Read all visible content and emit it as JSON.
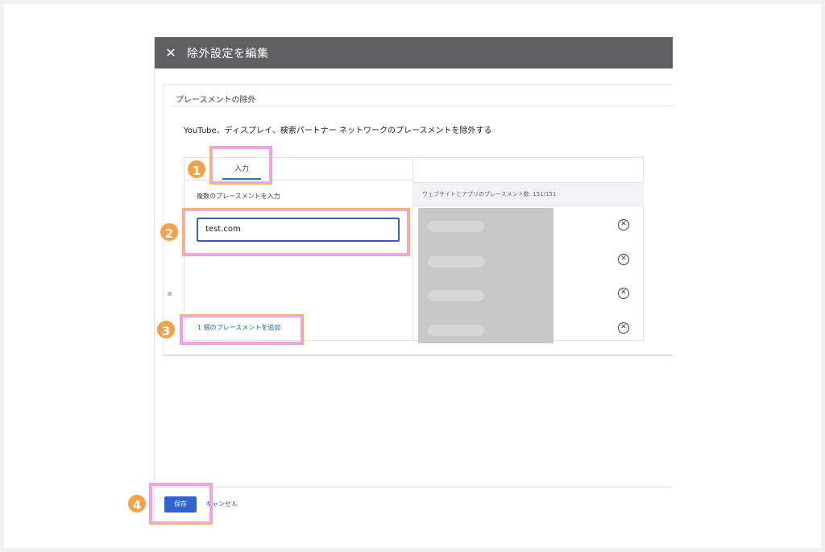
{
  "dialog": {
    "title": "除外設定を編集",
    "close_icon": "close-icon"
  },
  "section": {
    "title": "プレースメントの除外",
    "description": "YouTube、ディスプレイ、検索パートナー ネットワークのプレースメントを除外する"
  },
  "tabs": [
    {
      "label": "入力",
      "active": true
    }
  ],
  "input_panel": {
    "label": "複数のプレースメントを入力",
    "value": "test.com",
    "add_link": "1 個のプレースメントを追加"
  },
  "placements_panel": {
    "count_text": "ウェブサイトとアプリのプレースメント数: 151/151",
    "remove_icon": "remove-circle-icon"
  },
  "footer": {
    "save_label": "保存",
    "cancel_label": "キャンセル"
  },
  "callouts": [
    "1",
    "2",
    "3",
    "4"
  ],
  "colors": {
    "titlebar": "#5f6061",
    "primary": "#2f63d6",
    "highlight": "#f5a2e4",
    "badge": "#f5a14a"
  }
}
